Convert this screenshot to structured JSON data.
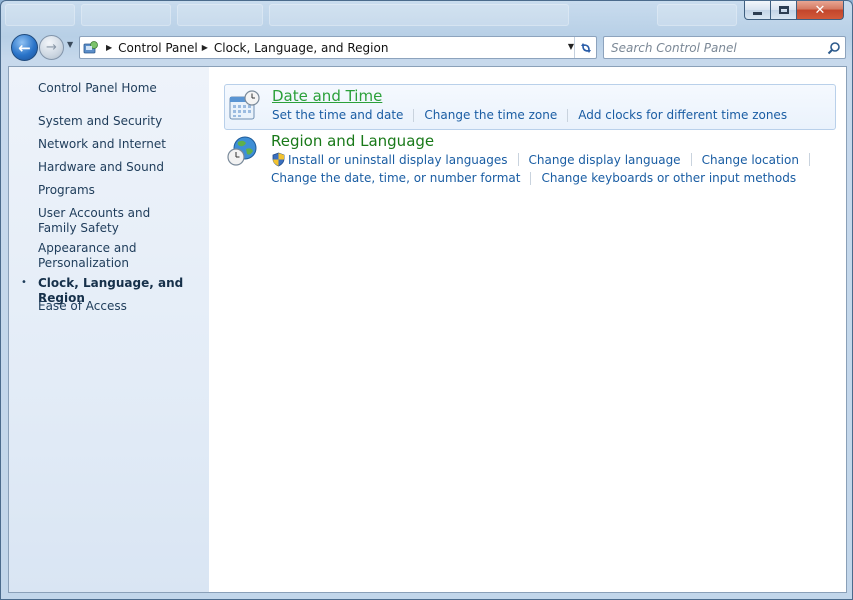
{
  "window": {
    "caption": {
      "minimize": "–",
      "maximize": "□",
      "close": "✕"
    }
  },
  "navbar": {
    "breadcrumb": [
      "Control Panel",
      "Clock, Language, and Region"
    ],
    "search_placeholder": "Search Control Panel",
    "icons": [
      "back-arrow-icon",
      "forward-arrow-icon",
      "control-panel-icon",
      "refresh-icon",
      "search-icon"
    ]
  },
  "sidebar": {
    "home": "Control Panel Home",
    "items": [
      {
        "label": "System and Security",
        "current": false
      },
      {
        "label": "Network and Internet",
        "current": false
      },
      {
        "label": "Hardware and Sound",
        "current": false
      },
      {
        "label": "Programs",
        "current": false
      },
      {
        "label": "User Accounts and Family Safety",
        "current": false
      },
      {
        "label": "Appearance and Personalization",
        "current": false
      },
      {
        "label": "Clock, Language, and Region",
        "current": true
      },
      {
        "label": "Ease of Access",
        "current": false
      }
    ],
    "bullet": "•"
  },
  "categories": [
    {
      "title": "Date and Time",
      "icon": "calendar-clock-icon",
      "links": [
        "Set the time and date",
        "Change the time zone",
        "Add clocks for different time zones"
      ]
    },
    {
      "title": "Region and Language",
      "icon": "globe-clock-icon",
      "links_row1": [
        "Install or uninstall display languages",
        "Change display language",
        "Change location"
      ],
      "links_row2": [
        "Change the date, time, or number format",
        "Change keyboards or other input methods"
      ]
    }
  ],
  "colors": {
    "link": "#1a5da3",
    "category_title": "#197919",
    "sidebar_bg": "#e3ecf7",
    "frame": "#c2d6ea"
  }
}
